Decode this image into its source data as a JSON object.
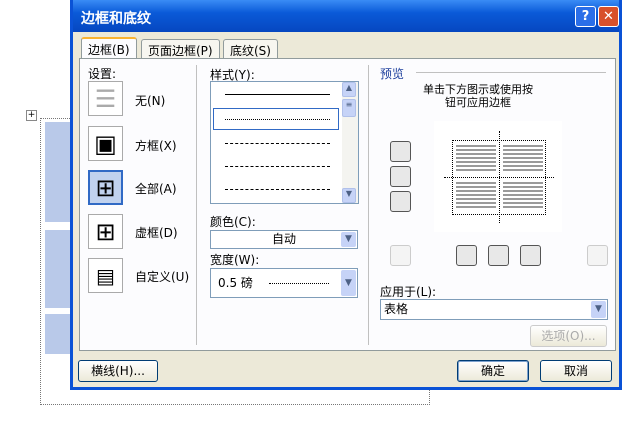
{
  "dialog": {
    "title": "边框和底纹",
    "help_label": "?",
    "close_label": "✕"
  },
  "tabs": [
    {
      "label": "边框(B)",
      "active": true
    },
    {
      "label": "页面边框(P)",
      "active": false
    },
    {
      "label": "底纹(S)",
      "active": false
    }
  ],
  "settings": {
    "label": "设置:",
    "items": [
      {
        "label": "无(N)",
        "selected": false
      },
      {
        "label": "方框(X)",
        "selected": false
      },
      {
        "label": "全部(A)",
        "selected": true
      },
      {
        "label": "虚框(D)",
        "selected": false
      },
      {
        "label": "自定义(U)",
        "selected": false
      }
    ]
  },
  "style": {
    "label": "样式(Y):"
  },
  "color": {
    "label": "颜色(C):",
    "value": "自动"
  },
  "width": {
    "label": "宽度(W):",
    "value": "0.5 磅"
  },
  "preview": {
    "label": "预览",
    "hint": "单击下方图示或使用按钮可应用边框"
  },
  "apply_to": {
    "label": "应用于(L):",
    "value": "表格"
  },
  "buttons": {
    "options": "选项(O)...",
    "horizontal_line": "横线(H)...",
    "ok": "确定",
    "cancel": "取消"
  },
  "colors": {
    "title_bar": "#0a5ad8",
    "selected": "#316ac5"
  }
}
